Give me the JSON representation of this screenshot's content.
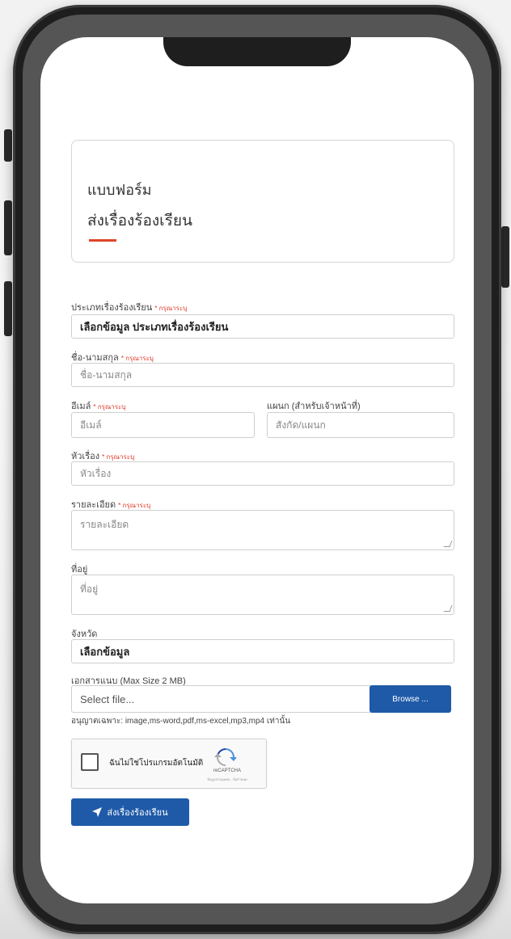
{
  "form": {
    "heading_line1": "แบบฟอร์ม",
    "heading_line2": "ส่งเรื่องร้องเรียน",
    "accent_color": "#e0452b",
    "primary_color": "#1f5aa8",
    "required_text": "* กรุณาระบุ",
    "complaint_type": {
      "label": "ประเภทเรื่องร้องเรียน",
      "value": "เลือกข้อมูล ประเภทเรื่องร้องเรียน"
    },
    "fullname": {
      "label": "ชื่อ-นามสกุล",
      "placeholder": "ชื่อ-นามสกุล"
    },
    "email": {
      "label": "อีเมล์",
      "placeholder": "อีเมล์"
    },
    "department": {
      "label": "แผนก (สำหรับเจ้าหน้าที่)",
      "placeholder": "สังกัด/แผนก"
    },
    "subject": {
      "label": "หัวเรื่อง",
      "placeholder": "หัวเรื่อง"
    },
    "details": {
      "label": "รายละเอียด",
      "placeholder": "รายละเอียด"
    },
    "address": {
      "label": "ที่อยู่",
      "placeholder": "ที่อยู่"
    },
    "province": {
      "label": "จังหวัด",
      "value": "เลือกข้อมูล"
    },
    "attachment": {
      "label": "เอกสารแนบ (Max Size 2 MB)",
      "placeholder": "Select file...",
      "browse_label": "Browse ...",
      "hint": "อนุญาตเฉพาะ: image,ms-word,pdf,ms-excel,mp3,mp4 เท่านั้น"
    },
    "captcha": {
      "text": "ฉันไม่ใช่โปรแกรมอัตโนมัติ",
      "brand": "reCAPTCHA",
      "terms": "ข้อมูลส่วนบุคคล - ข้อกำหนด"
    },
    "submit_label": "ส่งเรื่องร้องเรียน"
  }
}
